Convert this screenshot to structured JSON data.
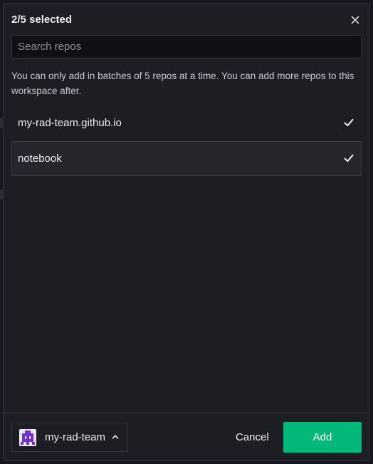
{
  "modal": {
    "title": "2/5 selected",
    "close_icon": "close-icon"
  },
  "search": {
    "placeholder": "Search repos",
    "value": ""
  },
  "notice": "You can only add in batches of 5 repos at a time. You can add more repos to this workspace after.",
  "repos": [
    {
      "name": "my-rad-team.github.io",
      "selected": true,
      "icon": "checkmark-icon"
    },
    {
      "name": "notebook",
      "selected": true,
      "icon": "checkmark-icon"
    }
  ],
  "footer": {
    "org_name": "my-rad-team",
    "org_chevron": "chevron-up-icon",
    "cancel_label": "Cancel",
    "add_label": "Add"
  },
  "colors": {
    "background": "#1c1e24",
    "accent": "#04b879",
    "avatar": "#6f2fd1"
  }
}
